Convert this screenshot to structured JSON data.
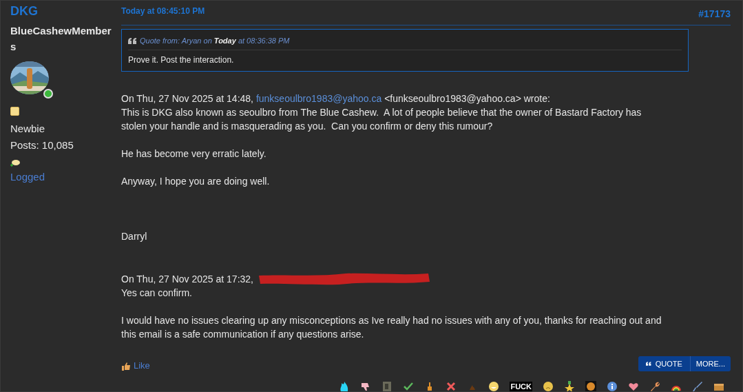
{
  "poster": {
    "name": "DKG",
    "group": "BlueCashewMembers",
    "online": true,
    "rank": "Newbie",
    "posts": "Posts: 10,085",
    "logged": "Logged"
  },
  "post": {
    "date": "Today at 08:45:10 PM",
    "number": "#17173",
    "quote": {
      "prefix": "Quote from: Aryan on",
      "day": "Today",
      "time": "at 08:36:38 PM",
      "text": "Prove it. Post the interaction."
    },
    "paragraphs": [
      {
        "kind": "header",
        "before": "On Thu, 27 Nov 2025 at 14:48,",
        "link": "funkseoulbro1983@yahoo.ca",
        "after": "<funkseoulbro1983@yahoo.ca> wrote:",
        "lines": [
          "This is DKG also known as seoulbro from The Blue Cashew.  A lot of people believe that the owner of Bastard Factory has",
          "stolen your handle and is masquerading as you.  Can you confirm or deny this rumour?"
        ]
      },
      {
        "kind": "text",
        "lines": [
          "He has become very erratic lately."
        ]
      },
      {
        "kind": "text",
        "lines": [
          "Anyway, I hope you are doing well."
        ]
      },
      {
        "kind": "signature",
        "lines": [
          "Darryl"
        ]
      },
      {
        "kind": "redacted_header",
        "before": "On Thu, 27 Nov 2025 at 17:32,",
        "lines": [
          "Yes can confirm."
        ]
      },
      {
        "kind": "text",
        "lines": [
          "I would have no issues clearing up any misconceptions as Ive really had no issues with any of you, thanks for reaching out and",
          "this email is a safe communication if any questions arise."
        ]
      }
    ],
    "like": "Like",
    "buttons": [
      "QUOTE",
      "MORE..."
    ],
    "reaction_badge": "FUCK"
  }
}
